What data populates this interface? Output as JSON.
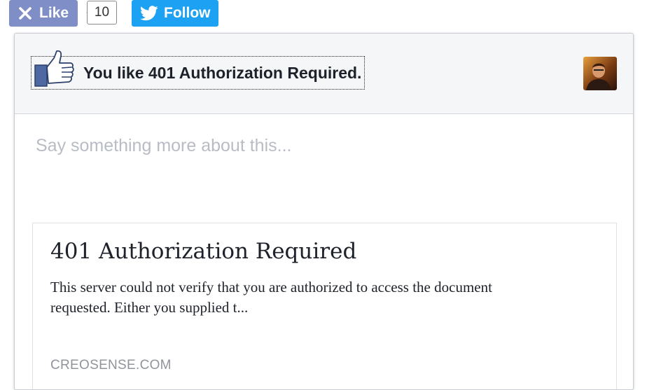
{
  "toolbar": {
    "like_label": "Like",
    "like_count": "10",
    "follow_label": "Follow"
  },
  "popup": {
    "you_like_text": "You like 401 Authorization Required.",
    "comment_placeholder": "Say something more about this...",
    "preview": {
      "title": "401 Authorization Required",
      "description": "This server could not verify that you are authorized to access the document requested. Either you supplied t...",
      "domain": "CREOSENSE.COM"
    }
  },
  "colors": {
    "like_button": "#7f8ec6",
    "follow_button": "#1da1f2",
    "thumb_blue": "#4e69a2",
    "header_bg": "#f5f6f7",
    "placeholder": "#b8bcc4",
    "domain_text": "#90949c"
  },
  "icons": {
    "like_button_icon": "close-icon",
    "follow_button_icon": "twitter-bird-icon",
    "header_icon": "thumbs-up-icon"
  }
}
